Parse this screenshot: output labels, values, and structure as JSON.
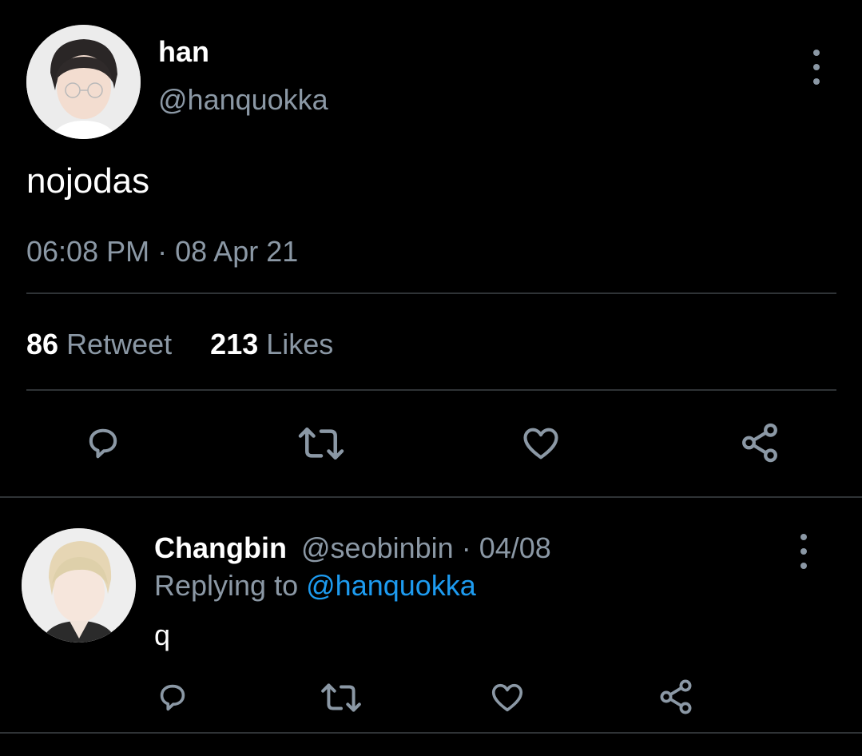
{
  "tweet": {
    "author_name": "han",
    "author_handle": "@hanquokka",
    "text": "nojodas",
    "time": "06:08 PM",
    "separator": "·",
    "date": "08 Apr 21",
    "retweet_count": "86",
    "retweet_label": "Retweet",
    "likes_count": "213",
    "likes_label": "Likes"
  },
  "reply": {
    "author_name": "Changbin",
    "author_handle": "@seobinbin",
    "separator": "·",
    "date": "04/08",
    "replying_prefix": "Replying to",
    "replying_handle": "@hanquokka",
    "text": "q"
  },
  "icons": {
    "reply": "reply-icon",
    "retweet": "retweet-icon",
    "like": "heart-icon",
    "share": "share-icon",
    "more": "more-icon"
  },
  "colors": {
    "background": "#000000",
    "text": "#ffffff",
    "muted": "#8b98a5",
    "link": "#1d9bf0",
    "divider": "#2f3336"
  }
}
